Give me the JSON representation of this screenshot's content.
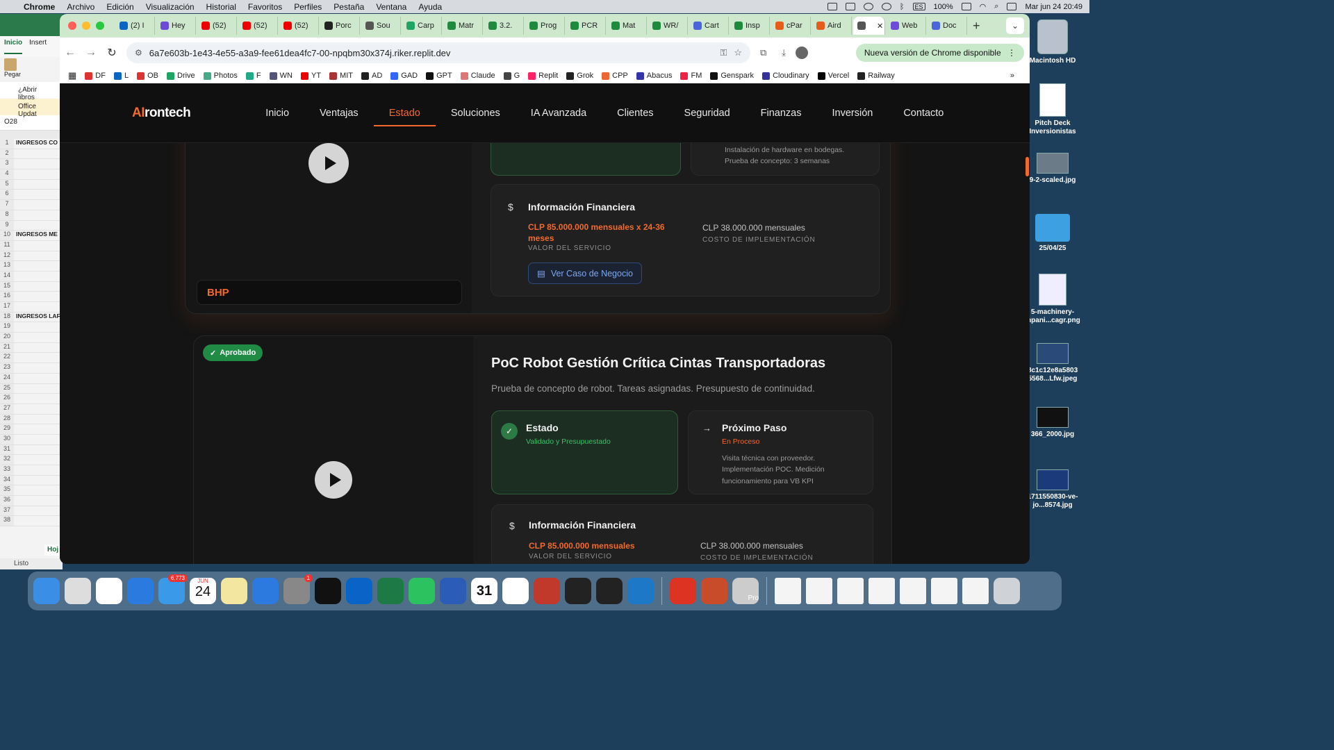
{
  "menubar": {
    "app": "Chrome",
    "items": [
      "Archivo",
      "Edición",
      "Visualización",
      "Historial",
      "Favoritos",
      "Perfiles",
      "Pestaña",
      "Ventana",
      "Ayuda"
    ],
    "input_lang": "ES",
    "battery": "100%",
    "datetime": "Mar jun 24  20:49"
  },
  "desktop": {
    "icons": [
      "Macintosh HD",
      "Pitch Deck Inversionistas",
      "9-2-scaled.jpg",
      "25/04/25",
      "5-machinery-mpani...cagr.png",
      "8c1c12e8a5803 5568...Lfw.jpeg",
      "366_2000.jpg",
      "1711550830-ve-jo...8574.jpg"
    ]
  },
  "excel": {
    "ribbon_tab": "Inicio",
    "ribbon_tab2": "Insert",
    "paste": "Pegar",
    "open_books": "¿Abrir libros",
    "office_update": "Office Updat",
    "cell_ref": "O28",
    "rows": [
      "1",
      "2",
      "3",
      "4",
      "5",
      "6",
      "7",
      "8",
      "9",
      "10",
      "11",
      "12",
      "13",
      "14",
      "15",
      "16",
      "17",
      "18",
      "19",
      "20",
      "21",
      "22",
      "23",
      "24",
      "25",
      "26",
      "27",
      "28",
      "29",
      "30",
      "31",
      "32",
      "33",
      "34",
      "35",
      "36",
      "37",
      "38"
    ],
    "labels": {
      "1": "INGRESOS CO",
      "10": "INGRESOS ME",
      "18": "INGRESOS LAF"
    },
    "status": "Listo",
    "sheet_tab": "Hoj"
  },
  "browser": {
    "tabs": [
      "(2) I",
      "Hey",
      "(52)",
      "(52)",
      "(52)",
      "Porc",
      "Sou",
      "Carp",
      "Matr",
      "3.2.",
      "Prog",
      "PCR",
      "Mat",
      "WR/",
      "Cart",
      "Insp",
      "cPar",
      "Aird",
      "",
      "Web",
      "Doc"
    ],
    "new_tab": "+",
    "url": "6a7e603b-1e43-4e55-a3a9-fee61dea4fc7-00-npqbm30x374j.riker.replit.dev",
    "update_button": "Nueva versión de Chrome disponible",
    "bookmarks": [
      "DF",
      "L",
      "OB",
      "Drive",
      "Photos",
      "F",
      "WN",
      "YT",
      "MIT",
      "AD",
      "GAD",
      "GPT",
      "Claude",
      "G",
      "Replit",
      "Grok",
      "CPP",
      "Abacus",
      "FM",
      "Genspark",
      "Cloudinary",
      "Vercel",
      "Railway"
    ],
    "bookmark_colors": [
      "#d33",
      "#0a66c2",
      "#d33",
      "#1fa463",
      "#4a8",
      "#2a8",
      "#557",
      "#e00",
      "#a33",
      "#222",
      "#36f",
      "#111",
      "#d77",
      "#444",
      "#f26",
      "#222",
      "#e63",
      "#33a",
      "#e24",
      "#111",
      "#339",
      "#000",
      "#222"
    ]
  },
  "site": {
    "logo_ai": "AI",
    "logo_rest": "rontech",
    "nav": [
      "Inicio",
      "Ventajas",
      "Estado",
      "Soluciones",
      "IA Avanzada",
      "Clientes",
      "Seguridad",
      "Finanzas",
      "Inversión",
      "Contacto"
    ],
    "active_nav": "Estado",
    "card1": {
      "client": "BHP",
      "next_step_lines": [
        "Instalación de hardware en bodegas.",
        "Prueba de concepto: 3 semanas"
      ],
      "fin_title": "Información Financiera",
      "service_value": "CLP 85.000.000 mensuales x 24-36 meses",
      "service_label": "VALOR DEL SERVICIO",
      "impl_value": "CLP 38.000.000 mensuales",
      "impl_label": "COSTO DE IMPLEMENTACIÓN",
      "case_button": "Ver Caso de Negocio"
    },
    "card2": {
      "badge": "Aprobado",
      "title": "PoC Robot Gestión Crítica Cintas Transportadoras",
      "subtitle": "Prueba de concepto de robot. Tareas asignadas. Presupuesto de continuidad.",
      "status_title": "Estado",
      "status_value": "Validado y Presupuestado",
      "next_title": "Próximo Paso",
      "next_value": "En Proceso",
      "next_desc": "Visita técnica con proveedor. Implementación POC. Medición funcionamiento para VB KPI",
      "fin_title": "Información Financiera",
      "service_value": "CLP 85.000.000 mensuales",
      "service_label": "VALOR DEL SERVICIO",
      "impl_value": "CLP 38.000.000 mensuales",
      "impl_label": "COSTO DE IMPLEMENTACIÓN"
    }
  },
  "dock": {
    "apps": [
      "finder",
      "launchpad",
      "chrome",
      "safari",
      "mail",
      "calendar",
      "notes",
      "keynote",
      "settings",
      "spotify",
      "outlook",
      "excel",
      "whatsapp",
      "word",
      "fantastical",
      "arc",
      "sheet-app",
      "tailscale",
      "github",
      "vscode",
      "acrobat",
      "powerpoint",
      "pro-app"
    ],
    "mail_badge": "6,773",
    "calendar_month": "JUN",
    "calendar_day": "24",
    "settings_badge": "1",
    "fantastical_day": "31",
    "pro_label": "Pro"
  },
  "colors": {
    "accent": "#f26a2e",
    "green": "#3fbf6a"
  }
}
